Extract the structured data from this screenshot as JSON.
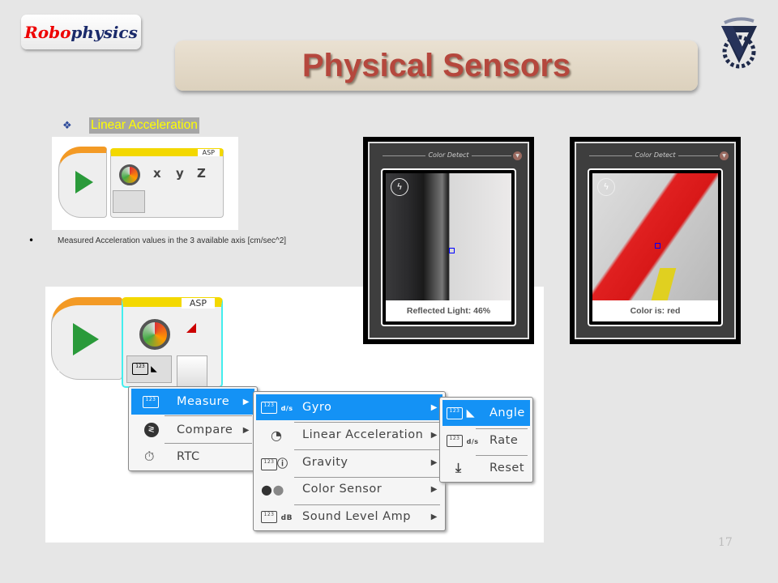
{
  "header": {
    "logo_text_red": "Robo",
    "logo_text_blue": "physics",
    "title": "Physical Sensors"
  },
  "section": {
    "bullet": "❖",
    "heading": "Linear Acceleration"
  },
  "block_small": {
    "tag": "ASP",
    "ports": [
      "x",
      "y",
      "z"
    ]
  },
  "description": {
    "bullet": "•",
    "text": "Measured Acceleration values in the 3 available axis [cm/sec^2]"
  },
  "phone_screens": [
    {
      "header": "Color Detect",
      "caption": "Reflected Light: 46%"
    },
    {
      "header": "Color Detect",
      "caption": "Color is: red"
    }
  ],
  "block_large": {
    "tag": "ASP"
  },
  "menu_main": [
    {
      "label": "Measure",
      "icon": "ruler-icon",
      "selected": true
    },
    {
      "label": "Compare",
      "icon": "compare-icon"
    },
    {
      "label": "RTC",
      "icon": "stopwatch-icon"
    }
  ],
  "menu_sensor": [
    {
      "label": "Gyro",
      "icon_badge": "d/s",
      "selected": true
    },
    {
      "label": "Linear Acceleration",
      "icon": "gauge-icon"
    },
    {
      "label": "Gravity",
      "icon": "hash-icon"
    },
    {
      "label": "Color Sensor",
      "icon": "color-dots-icon"
    },
    {
      "label": "Sound Level Amp",
      "icon_badge": "dB"
    }
  ],
  "menu_gyro": [
    {
      "label": "Angle",
      "selected": true
    },
    {
      "label": "Rate",
      "icon_badge": "d/s"
    },
    {
      "label": "Reset"
    }
  ],
  "colors": {
    "menu_highlight": "#1492f5",
    "title": "#b5473d",
    "subheading_bg": "#a6a6a6",
    "subheading_text": "#ffff00"
  },
  "page_number": "17"
}
